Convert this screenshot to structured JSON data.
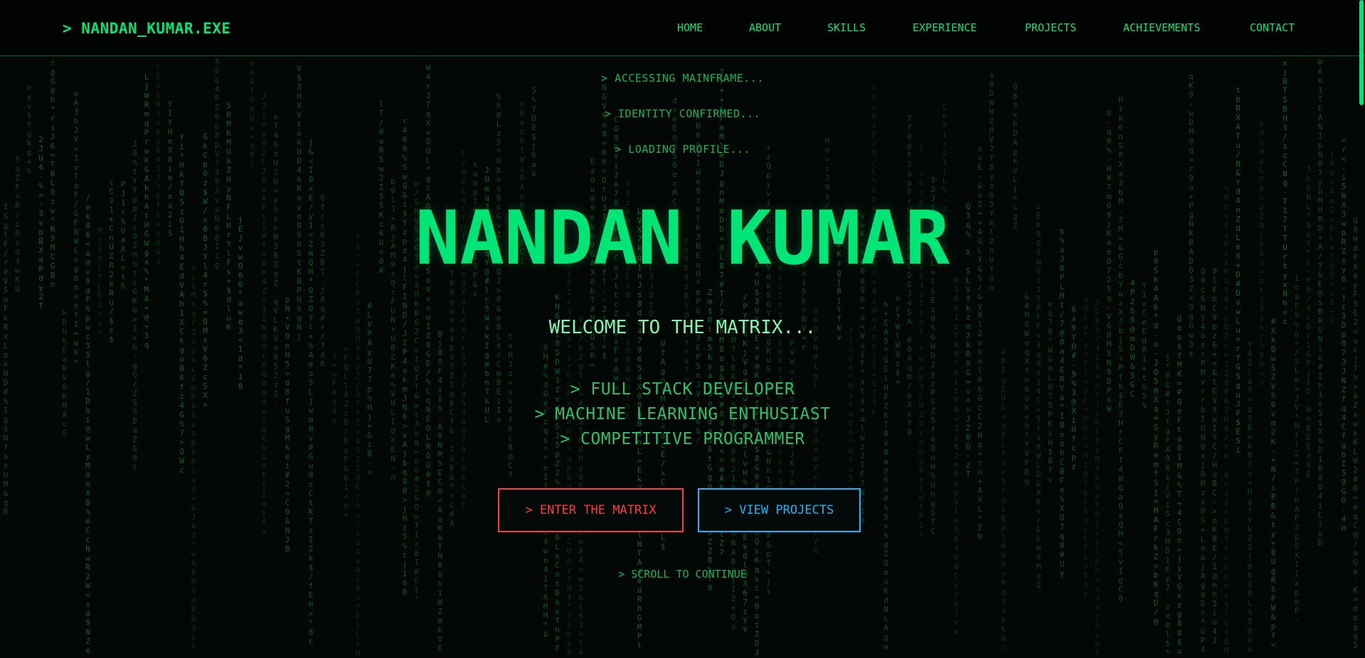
{
  "nav": {
    "logo": "> NANDAN_KUMAR.EXE",
    "links": [
      "HOME",
      "ABOUT",
      "SKILLS",
      "EXPERIENCE",
      "PROJECTS",
      "ACHIEVEMENTS",
      "CONTACT"
    ]
  },
  "hero": {
    "status_lines": [
      "> ACCESSING MAINFRAME...",
      "> IDENTITY CONFIRMED...",
      "> LOADING PROFILE..."
    ],
    "name": "NANDAN KUMAR",
    "welcome": "WELCOME TO THE MATRIX...",
    "roles": [
      "> FULL STACK DEVELOPER",
      "> MACHINE LEARNING ENTHUSIAST",
      "> COMPETITIVE PROGRAMMER"
    ],
    "primary_button": "> ENTER THE MATRIX",
    "secondary_button": "> VIEW PROJECTS",
    "scroll_hint": "> SCROLL TO CONTINUE"
  },
  "colors": {
    "accent": "#00e676",
    "background": "#030806",
    "primary_button": "#ff3b3b",
    "secondary_button": "#18b6ff"
  }
}
